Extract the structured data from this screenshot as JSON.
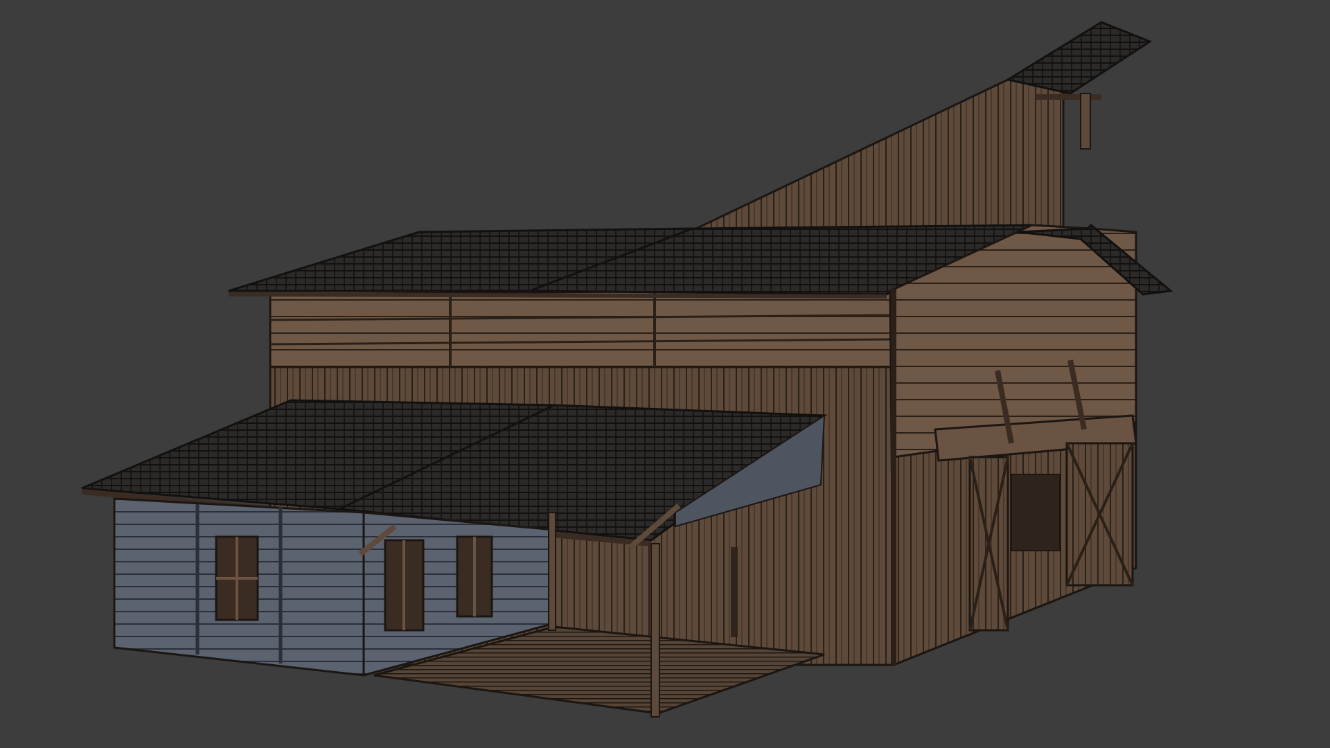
{
  "viewport": {
    "background_color": "#3d3d3d"
  },
  "model": {
    "subject": "weathered-wooden-barn",
    "colors": {
      "wood_light": "#7d6550",
      "wood_mid": "#5e4a3a",
      "wood_dark": "#3a2c22",
      "roof": "#2c2a29",
      "roof_line": "#121110",
      "annex_paint": "#5b6270",
      "outline": "#1c1612"
    }
  }
}
